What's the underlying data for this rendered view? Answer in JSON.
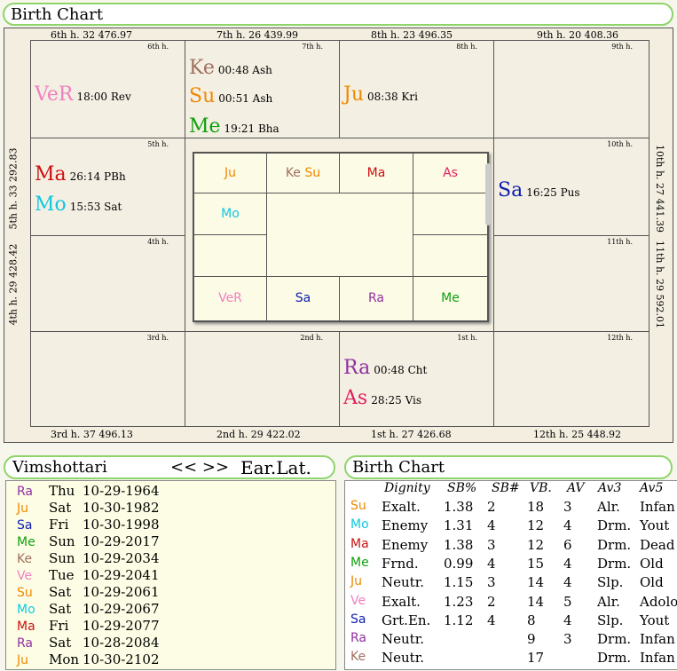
{
  "birth_chart_panel": {
    "title": "Birth Chart",
    "edges": {
      "top": [
        "6th h.  32  476.97",
        "7th h.  26  439.99",
        "8th h.  23  496.35",
        "9th h.  20  408.36"
      ],
      "bottom": [
        "3rd h.  37  496.13",
        "2nd h.  29  422.02",
        "1st h.  27  426.68",
        "12th h.  25  448.92"
      ],
      "left": [
        "5th h.  33  292.83",
        "4th h.  29  428.42"
      ],
      "right": [
        "10th h.  27  441.39",
        "11th h.  29  592.01"
      ]
    },
    "houses": {
      "h6": {
        "num": "6th h.",
        "planets": [
          {
            "ab": "VeR",
            "deg": "18:00 Rev",
            "color": "#f080c0"
          }
        ]
      },
      "h7": {
        "num": "7th h.",
        "planets": [
          {
            "ab": "Ke",
            "deg": "00:48 Ash",
            "color": "#a07060"
          },
          {
            "ab": "Su",
            "deg": "00:51 Ash",
            "color": "#ee8800"
          },
          {
            "ab": "Me",
            "deg": "19:21 Bha",
            "color": "#10a010"
          }
        ]
      },
      "h8": {
        "num": "8th h.",
        "planets": [
          {
            "ab": "Ju",
            "deg": "08:38 Kri",
            "color": "#ee8800"
          }
        ]
      },
      "h9": {
        "num": "9th h.",
        "planets": []
      },
      "h5": {
        "num": "5th h.",
        "planets": [
          {
            "ab": "Ma",
            "deg": "26:14 PBh",
            "color": "#cc1010"
          },
          {
            "ab": "Mo",
            "deg": "15:53 Sat",
            "color": "#10c8e0"
          }
        ]
      },
      "h10": {
        "num": "10th h.",
        "planets": [
          {
            "ab": "Sa",
            "deg": "16:25 Pus",
            "color": "#1020b0"
          }
        ]
      },
      "h4": {
        "num": "4th h.",
        "planets": []
      },
      "h11": {
        "num": "11th h.",
        "planets": []
      },
      "h3": {
        "num": "3rd h.",
        "planets": []
      },
      "h2": {
        "num": "2nd h.",
        "planets": []
      },
      "h1": {
        "num": "1st h.",
        "planets": [
          {
            "ab": "Ra",
            "deg": "00:48 Cht",
            "color": "#9030a0"
          },
          {
            "ab": "As",
            "deg": "28:25 Vis",
            "color": "#e02060"
          }
        ]
      },
      "h12": {
        "num": "12th h.",
        "planets": []
      }
    },
    "center_grid": {
      "top": [
        "Ju",
        [
          "Ke",
          "Su"
        ],
        "Ma",
        "As"
      ],
      "mid_left": "Mo",
      "bottom": [
        "VeR",
        "Sa",
        "Ra",
        "Me"
      ]
    }
  },
  "vimshottari": {
    "title": "Vimshottari",
    "nav": "<< >>",
    "mode": "Ear.Lat.",
    "rows": [
      {
        "p": "Ra",
        "c": "#9030a0",
        "day": "Thu",
        "date": "10-29-1964"
      },
      {
        "p": "Ju",
        "c": "#ee8800",
        "day": "Sat",
        "date": "10-30-1982"
      },
      {
        "p": "Sa",
        "c": "#1020b0",
        "day": "Fri",
        "date": "10-30-1998"
      },
      {
        "p": "Me",
        "c": "#10a010",
        "day": "Sun",
        "date": "10-29-2017"
      },
      {
        "p": "Ke",
        "c": "#a07060",
        "day": "Sun",
        "date": "10-29-2034"
      },
      {
        "p": "Ve",
        "c": "#f080c0",
        "day": "Tue",
        "date": "10-29-2041"
      },
      {
        "p": "Su",
        "c": "#ee8800",
        "day": "Sat",
        "date": "10-29-2061"
      },
      {
        "p": "Mo",
        "c": "#10c8e0",
        "day": "Sat",
        "date": "10-29-2067"
      },
      {
        "p": "Ma",
        "c": "#cc1010",
        "day": "Fri",
        "date": "10-29-2077"
      },
      {
        "p": "Ra",
        "c": "#9030a0",
        "day": "Sat",
        "date": "10-28-2084"
      },
      {
        "p": "Ju",
        "c": "#ee8800",
        "day": "Mon",
        "date": "10-30-2102"
      }
    ]
  },
  "dignity_panel": {
    "title": "Birth Chart",
    "headers": [
      "Dignity",
      "SB%",
      "SB#",
      "VB.",
      "AV",
      "Av3",
      "Av5"
    ],
    "rows": [
      {
        "p": "Su",
        "c": "#ee8800",
        "cells": [
          "Exalt.",
          "1.38",
          "2",
          "18",
          "3",
          "Alr.",
          "Infan"
        ]
      },
      {
        "p": "Mo",
        "c": "#10c8e0",
        "cells": [
          "Enemy",
          "1.31",
          "4",
          "12",
          "4",
          "Drm.",
          "Yout"
        ]
      },
      {
        "p": "Ma",
        "c": "#cc1010",
        "cells": [
          "Enemy",
          "1.38",
          "3",
          "12",
          "6",
          "Drm.",
          "Dead"
        ]
      },
      {
        "p": "Me",
        "c": "#10a010",
        "cells": [
          "Frnd.",
          "0.99",
          "4",
          "15",
          "4",
          "Drm.",
          "Old"
        ]
      },
      {
        "p": "Ju",
        "c": "#ee8800",
        "cells": [
          "Neutr.",
          "1.15",
          "3",
          "14",
          "4",
          "Slp.",
          "Old"
        ]
      },
      {
        "p": "Ve",
        "c": "#f080c0",
        "cells": [
          "Exalt.",
          "1.23",
          "2",
          "14",
          "5",
          "Alr.",
          "Adolo"
        ]
      },
      {
        "p": "Sa",
        "c": "#1020b0",
        "cells": [
          "Grt.En.",
          "1.12",
          "4",
          "8",
          "4",
          "Slp.",
          "Yout"
        ]
      },
      {
        "p": "Ra",
        "c": "#9030a0",
        "cells": [
          "Neutr.",
          "",
          "",
          "9",
          "3",
          "Drm.",
          "Infan"
        ]
      },
      {
        "p": "Ke",
        "c": "#a07060",
        "cells": [
          "Neutr.",
          "",
          "",
          "17",
          "",
          "Drm.",
          "Infan"
        ]
      }
    ]
  }
}
